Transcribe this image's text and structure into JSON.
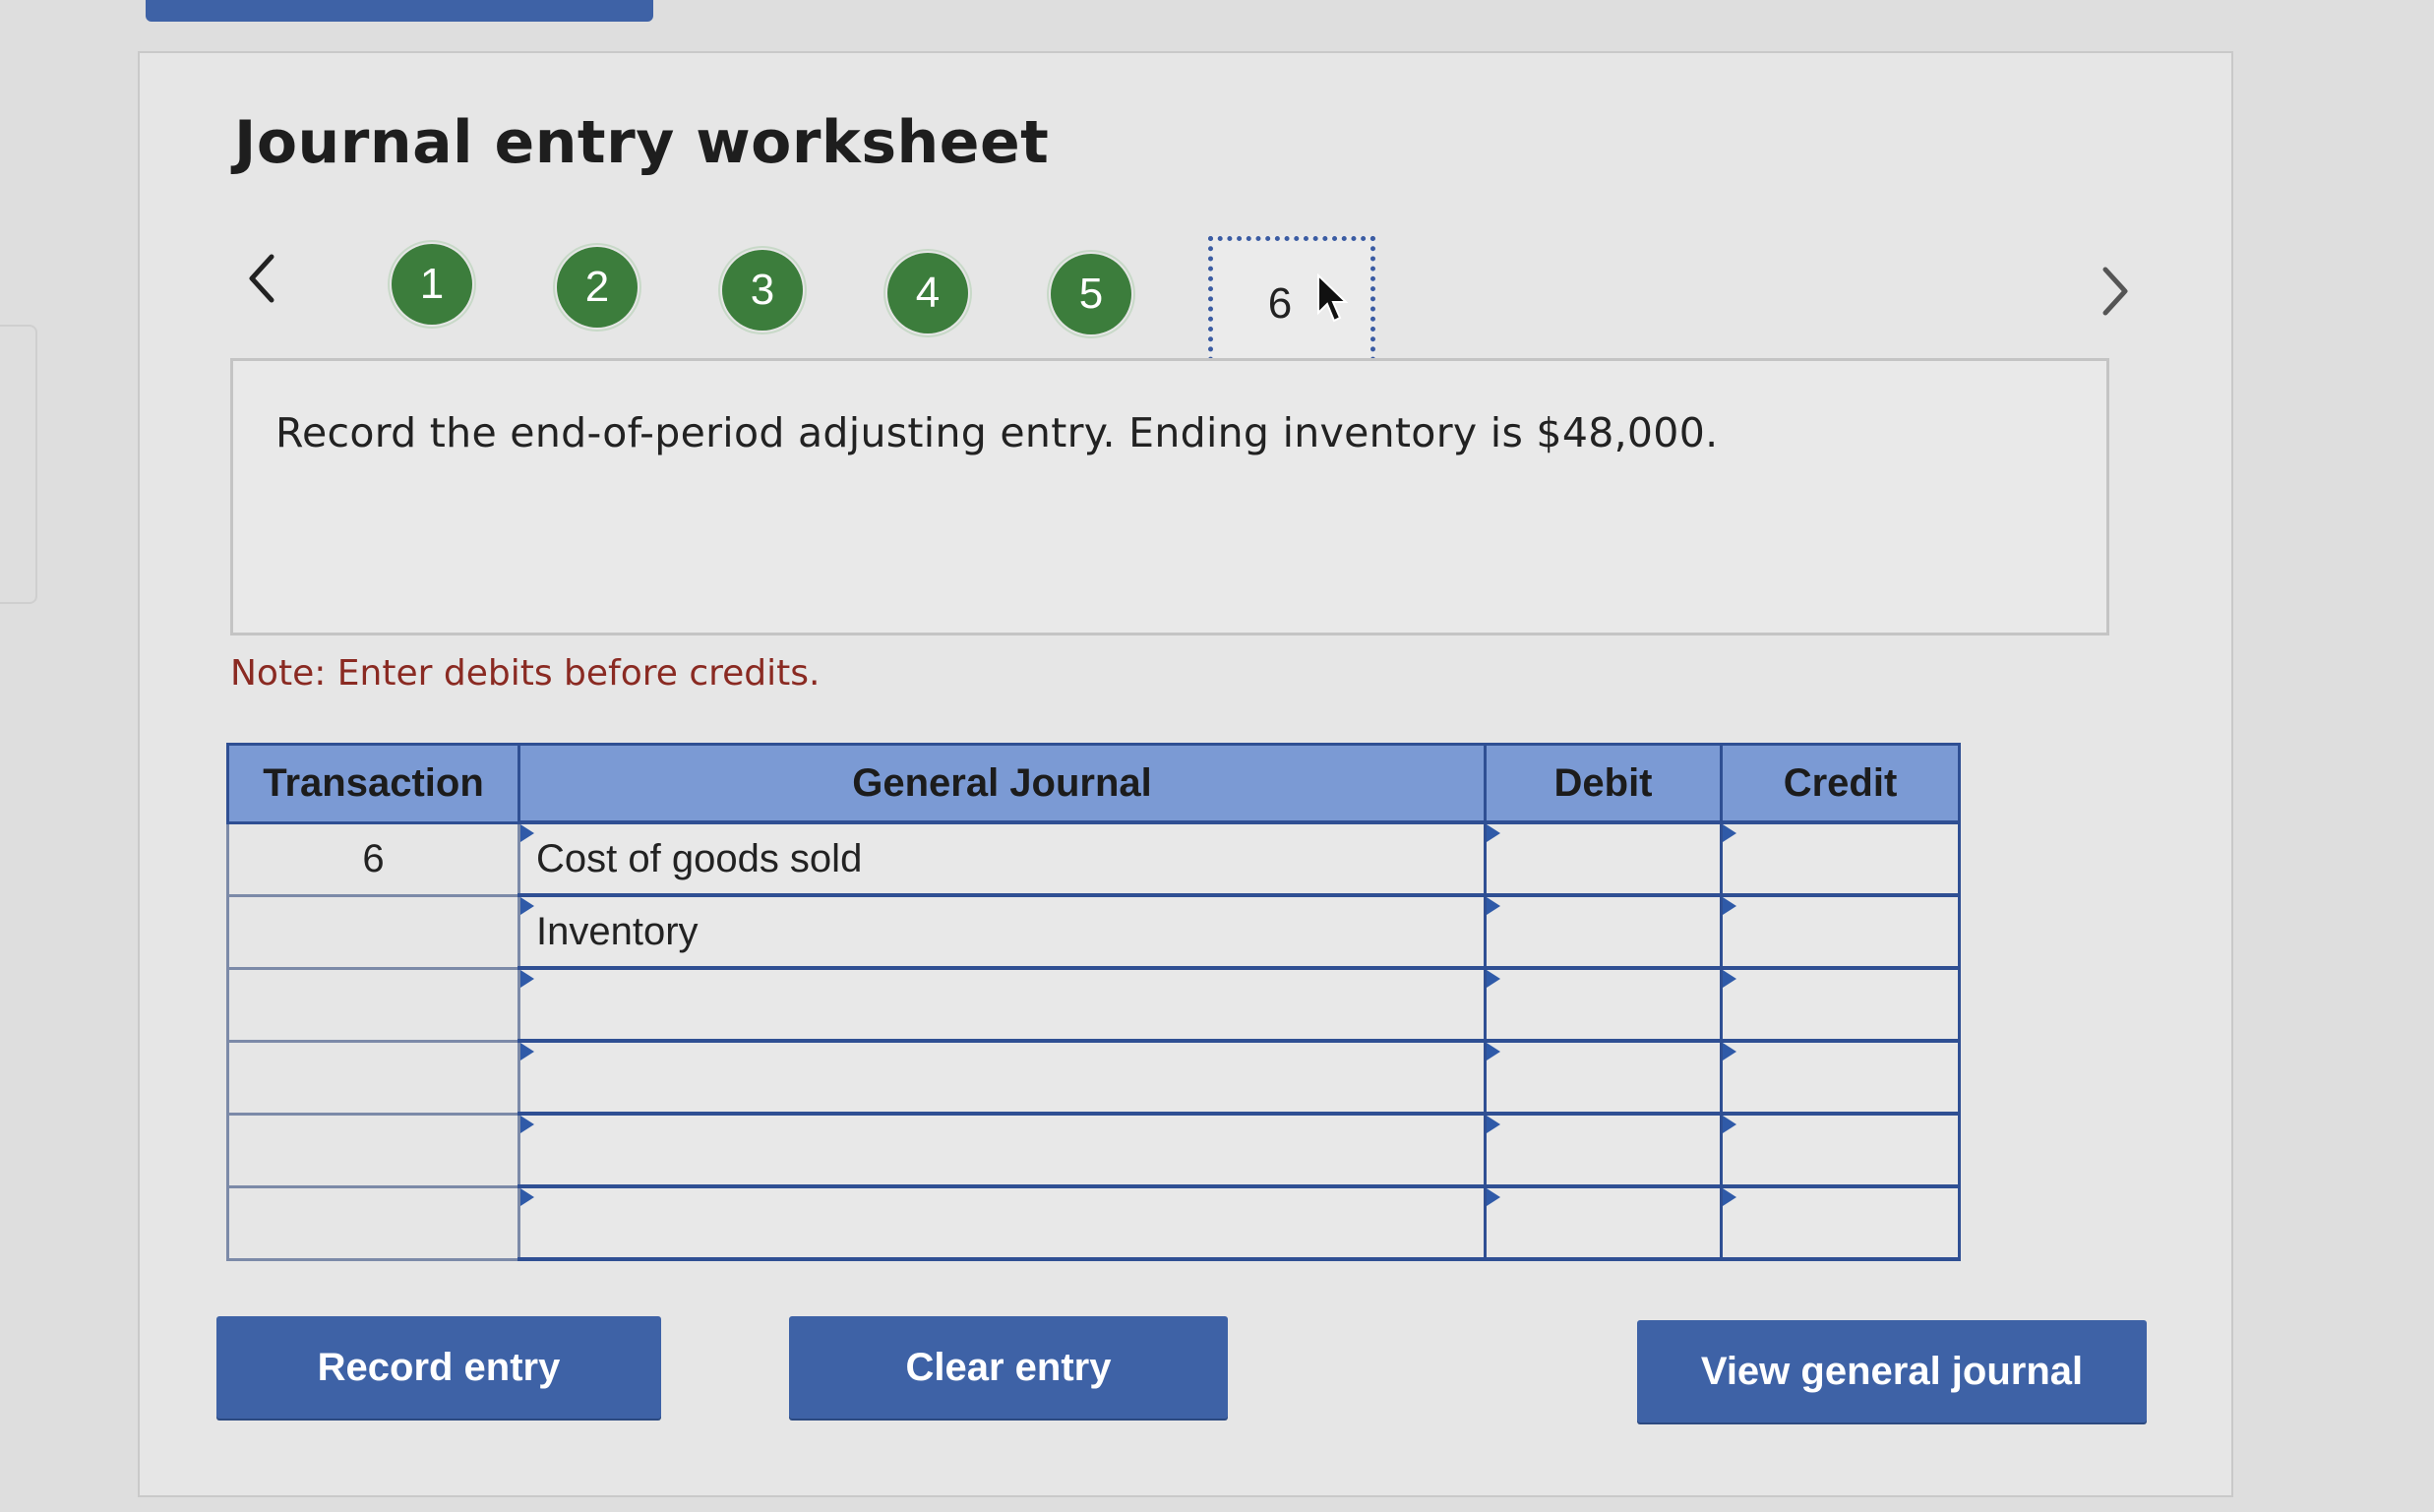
{
  "title": "Journal entry worksheet",
  "nav": {
    "steps": [
      "1",
      "2",
      "3",
      "4",
      "5",
      "6"
    ],
    "current_step": "6"
  },
  "prompt": "Record the end-of-period adjusting entry. Ending inventory is $48,000.",
  "note": "Note: Enter debits before credits.",
  "table": {
    "headers": [
      "Transaction",
      "General Journal",
      "Debit",
      "Credit"
    ],
    "rows": [
      {
        "transaction": "6",
        "account": "Cost of goods sold",
        "debit": "",
        "credit": ""
      },
      {
        "transaction": "",
        "account": "Inventory",
        "debit": "",
        "credit": ""
      },
      {
        "transaction": "",
        "account": "",
        "debit": "",
        "credit": ""
      },
      {
        "transaction": "",
        "account": "",
        "debit": "",
        "credit": ""
      },
      {
        "transaction": "",
        "account": "",
        "debit": "",
        "credit": ""
      },
      {
        "transaction": "",
        "account": "",
        "debit": "",
        "credit": ""
      }
    ]
  },
  "buttons": {
    "record": "Record entry",
    "clear": "Clear entry",
    "view": "View general journal"
  },
  "colors": {
    "button_blue": "#3e62a6",
    "step_green": "#3c7d3c",
    "header_blue": "#7b9ad4",
    "note_red": "#8a2a22"
  },
  "icons": {
    "prev": "chevron-left-icon",
    "next": "chevron-right-icon",
    "cursor": "mouse-pointer-icon"
  }
}
